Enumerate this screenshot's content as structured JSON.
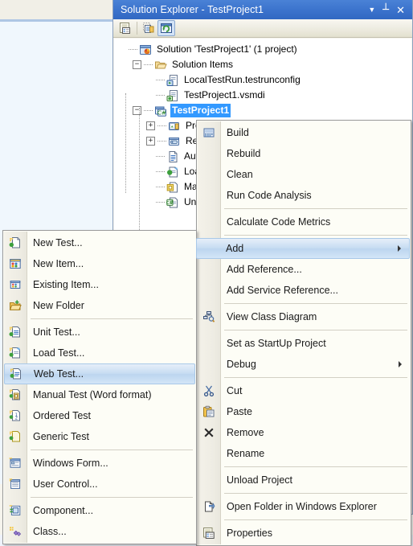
{
  "window": {
    "title": "Solution Explorer - TestProject1",
    "titlebar_color": "#3c74cd",
    "buttons": [
      {
        "name": "dropdown",
        "glyph": "▼"
      },
      {
        "name": "auto-hide-pin",
        "glyph": "┴"
      },
      {
        "name": "close",
        "glyph": "✕"
      }
    ],
    "toolbar": [
      {
        "name": "properties-icon",
        "label": "Properties"
      },
      {
        "name": "show-all-files-icon",
        "label": "Show All Files"
      },
      {
        "name": "refresh-icon",
        "label": "Refresh",
        "active": true
      }
    ]
  },
  "tree": {
    "nodes": [
      {
        "label": "Solution 'TestProject1' (1 project)",
        "depth": 0,
        "icon": "solution-icon",
        "expander": "none",
        "selected": false
      },
      {
        "label": "Solution Items",
        "depth": 1,
        "icon": "folder-open-icon",
        "expander": "minus",
        "selected": false
      },
      {
        "label": "LocalTestRun.testrunconfig",
        "depth": 2,
        "icon": "testrunconfig-icon",
        "expander": "none",
        "selected": false
      },
      {
        "label": "TestProject1.vsmdi",
        "depth": 2,
        "icon": "vsmdi-icon",
        "expander": "none",
        "selected": false
      },
      {
        "label": "TestProject1",
        "depth": 1,
        "icon": "csproj-icon",
        "expander": "minus",
        "selected": true
      },
      {
        "label": "Properties",
        "depth": 2,
        "icon": "properties-folder-icon",
        "expander": "plus",
        "selected": false
      },
      {
        "label": "References",
        "depth": 2,
        "icon": "references-icon",
        "expander": "plus",
        "selected": false
      },
      {
        "label": "AuthoringTests.txt",
        "depth": 2,
        "icon": "text-file-icon",
        "expander": "none",
        "selected": false
      },
      {
        "label": "LoadTest1.loadtest",
        "depth": 2,
        "icon": "loadtest-icon",
        "expander": "none",
        "selected": false
      },
      {
        "label": "ManualTest1.mht",
        "depth": 2,
        "icon": "manualtest-icon",
        "expander": "none",
        "selected": false
      },
      {
        "label": "UnitTest1.cs",
        "depth": 2,
        "icon": "csharp-file-icon",
        "expander": "none",
        "selected": false
      }
    ]
  },
  "project_context_menu": {
    "name": "project-context-menu",
    "items": [
      {
        "label": "Build",
        "icon": "build-icon",
        "type": "item"
      },
      {
        "label": "Rebuild",
        "icon": "",
        "type": "item"
      },
      {
        "label": "Clean",
        "icon": "",
        "type": "item"
      },
      {
        "label": "Run Code Analysis",
        "icon": "",
        "type": "item"
      },
      {
        "type": "separator"
      },
      {
        "label": "Calculate Code Metrics",
        "icon": "",
        "type": "item"
      },
      {
        "type": "separator"
      },
      {
        "label": "Add",
        "icon": "",
        "type": "item",
        "submenu": true,
        "highlighted": true
      },
      {
        "label": "Add Reference...",
        "icon": "",
        "type": "item"
      },
      {
        "label": "Add Service Reference...",
        "icon": "",
        "type": "item"
      },
      {
        "type": "separator"
      },
      {
        "label": "View Class Diagram",
        "icon": "class-diagram-icon",
        "type": "item"
      },
      {
        "type": "separator"
      },
      {
        "label": "Set as StartUp Project",
        "icon": "",
        "type": "item"
      },
      {
        "label": "Debug",
        "icon": "",
        "type": "item",
        "submenu": true
      },
      {
        "type": "separator"
      },
      {
        "label": "Cut",
        "icon": "cut-icon",
        "type": "item"
      },
      {
        "label": "Paste",
        "icon": "paste-icon",
        "type": "item"
      },
      {
        "label": "Remove",
        "icon": "remove-icon",
        "type": "item"
      },
      {
        "label": "Rename",
        "icon": "",
        "type": "item"
      },
      {
        "type": "separator"
      },
      {
        "label": "Unload Project",
        "icon": "",
        "type": "item"
      },
      {
        "type": "separator"
      },
      {
        "label": "Open Folder in Windows Explorer",
        "icon": "open-folder-icon",
        "type": "item"
      },
      {
        "type": "separator"
      },
      {
        "label": "Properties",
        "icon": "properties-icon",
        "type": "item"
      }
    ]
  },
  "add_submenu": {
    "name": "add-submenu",
    "items": [
      {
        "label": "New Test...",
        "icon": "new-test-icon",
        "type": "item"
      },
      {
        "label": "New Item...",
        "icon": "new-item-icon",
        "type": "item"
      },
      {
        "label": "Existing Item...",
        "icon": "existing-item-icon",
        "type": "item"
      },
      {
        "label": "New Folder",
        "icon": "new-folder-icon",
        "type": "item"
      },
      {
        "type": "separator"
      },
      {
        "label": "Unit Test...",
        "icon": "unit-test-icon",
        "type": "item"
      },
      {
        "label": "Load Test...",
        "icon": "load-test-icon",
        "type": "item"
      },
      {
        "label": "Web Test...",
        "icon": "web-test-icon",
        "type": "item",
        "highlighted": true
      },
      {
        "label": "Manual Test (Word format)",
        "icon": "manual-test-icon",
        "type": "item"
      },
      {
        "label": "Ordered Test",
        "icon": "ordered-test-icon",
        "type": "item"
      },
      {
        "label": "Generic Test",
        "icon": "generic-test-icon",
        "type": "item"
      },
      {
        "type": "separator"
      },
      {
        "label": "Windows Form...",
        "icon": "windows-form-icon",
        "type": "item"
      },
      {
        "label": "User Control...",
        "icon": "user-control-icon",
        "type": "item"
      },
      {
        "type": "separator"
      },
      {
        "label": "Component...",
        "icon": "component-icon",
        "type": "item"
      },
      {
        "label": "Class...",
        "icon": "class-icon",
        "type": "item"
      }
    ]
  }
}
